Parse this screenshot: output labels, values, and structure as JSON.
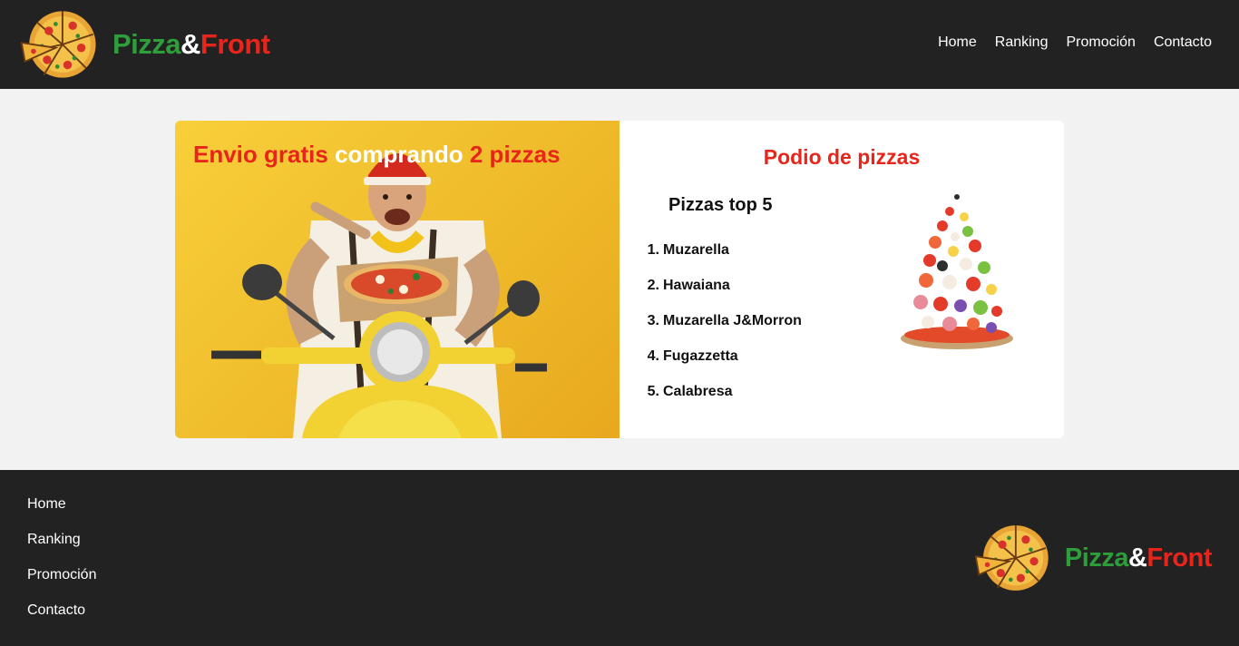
{
  "header": {
    "brand": {
      "part1": "Pizza",
      "part2": "&",
      "part3": "Front"
    },
    "nav": [
      {
        "label": "Home"
      },
      {
        "label": "Ranking"
      },
      {
        "label": "Promoción"
      },
      {
        "label": "Contacto"
      }
    ]
  },
  "promo": {
    "title_red_1": "Envio gratis",
    "title_white": "comprando",
    "title_red_2": "2 pizzas"
  },
  "podio": {
    "title": "Podio de pizzas",
    "subtitle": "Pizzas top 5",
    "items": [
      {
        "num": "1.",
        "name": "Muzarella"
      },
      {
        "num": "2.",
        "name": "Hawaiana"
      },
      {
        "num": "3.",
        "name": "Muzarella J&Morron"
      },
      {
        "num": "4.",
        "name": "Fugazzetta"
      },
      {
        "num": "5.",
        "name": "Calabresa"
      }
    ]
  },
  "footer": {
    "links": [
      {
        "label": "Home"
      },
      {
        "label": "Ranking"
      },
      {
        "label": "Promoción"
      },
      {
        "label": "Contacto"
      }
    ],
    "brand": {
      "part1": "Pizza",
      "part2": "&",
      "part3": "Front"
    }
  },
  "colors": {
    "header_bg": "#222222",
    "brand_green": "#2e9e3a",
    "brand_red": "#e8251b",
    "promo_yellow": "#f5c832",
    "page_bg": "#f2f2f2"
  },
  "icons": {
    "logo": "pizza-logo-icon",
    "promo_image": "delivery-scooter-image",
    "podio_image": "flying-pizza-ingredients-image"
  }
}
